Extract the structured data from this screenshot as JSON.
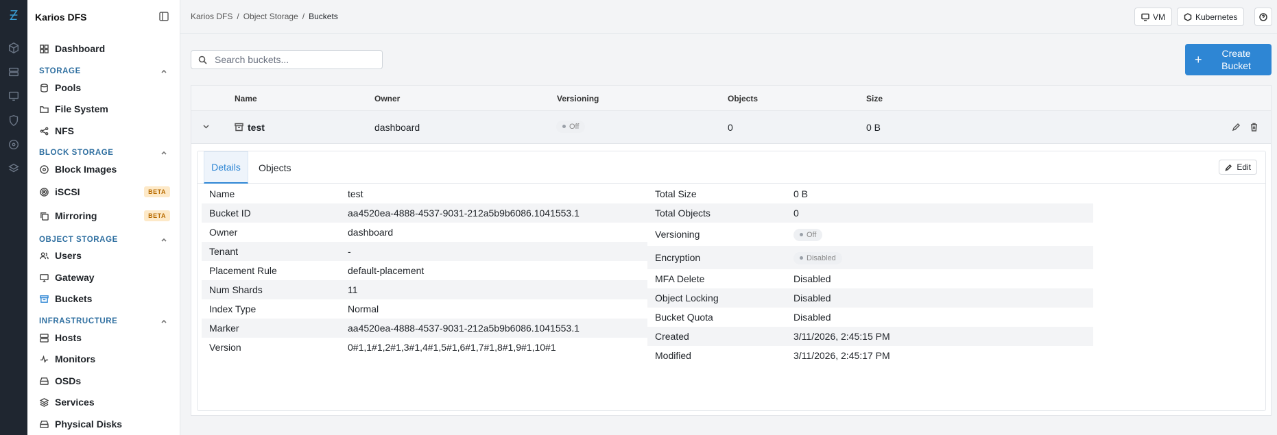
{
  "app": {
    "title": "Karios DFS"
  },
  "sidebar": {
    "dashboard": "Dashboard",
    "sections": {
      "storage": "STORAGE",
      "block_storage": "BLOCK STORAGE",
      "object_storage": "OBJECT STORAGE",
      "infrastructure": "INFRASTRUCTURE"
    },
    "items": {
      "pools": "Pools",
      "file_system": "File System",
      "nfs": "NFS",
      "block_images": "Block Images",
      "iscsi": "iSCSI",
      "mirroring": "Mirroring",
      "users": "Users",
      "gateway": "Gateway",
      "buckets": "Buckets",
      "hosts": "Hosts",
      "monitors": "Monitors",
      "osds": "OSDs",
      "services": "Services",
      "physical_disks": "Physical Disks"
    },
    "badge_beta": "BETA"
  },
  "breadcrumb": {
    "level1": "Karios DFS",
    "level2": "Object Storage",
    "current": "Buckets",
    "sep": "/"
  },
  "topbar": {
    "vm": "VM",
    "kubernetes": "Kubernetes"
  },
  "search": {
    "placeholder": "Search buckets..."
  },
  "create_button": {
    "label_line1": "Create",
    "label_line2": "Bucket"
  },
  "table": {
    "columns": {
      "name": "Name",
      "owner": "Owner",
      "versioning": "Versioning",
      "objects": "Objects",
      "size": "Size"
    },
    "row": {
      "name": "test",
      "owner": "dashboard",
      "versioning": "Off",
      "objects": "0",
      "size": "0 B"
    }
  },
  "details": {
    "tabs": {
      "details": "Details",
      "objects": "Objects"
    },
    "edit": "Edit",
    "left": [
      {
        "k": "Name",
        "v": "test"
      },
      {
        "k": "Bucket ID",
        "v": "aa4520ea-4888-4537-9031-212a5b9b6086.1041553.1"
      },
      {
        "k": "Owner",
        "v": "dashboard"
      },
      {
        "k": "Tenant",
        "v": "-"
      },
      {
        "k": "Placement Rule",
        "v": "default-placement"
      },
      {
        "k": "Num Shards",
        "v": "11"
      },
      {
        "k": "Index Type",
        "v": "Normal"
      },
      {
        "k": "Marker",
        "v": "aa4520ea-4888-4537-9031-212a5b9b6086.1041553.1"
      },
      {
        "k": "Version",
        "v": "0#1,1#1,2#1,3#1,4#1,5#1,6#1,7#1,8#1,9#1,10#1"
      }
    ],
    "right": [
      {
        "k": "Total Size",
        "v": "0 B"
      },
      {
        "k": "Total Objects",
        "v": "0"
      },
      {
        "k": "Versioning",
        "v": "Off"
      },
      {
        "k": "Encryption",
        "v": "Disabled"
      },
      {
        "k": "MFA Delete",
        "v": "Disabled"
      },
      {
        "k": "Object Locking",
        "v": "Disabled"
      },
      {
        "k": "Bucket Quota",
        "v": "Disabled"
      },
      {
        "k": "Created",
        "v": "3/11/2026, 2:45:15 PM"
      },
      {
        "k": "Modified",
        "v": "3/11/2026, 2:45:17 PM"
      }
    ]
  },
  "colors": {
    "accent": "#2e86d4",
    "rail": "#1f2630",
    "section": "#2f6fa0",
    "beta_bg": "#fde9c8",
    "beta_fg": "#b86b00"
  }
}
